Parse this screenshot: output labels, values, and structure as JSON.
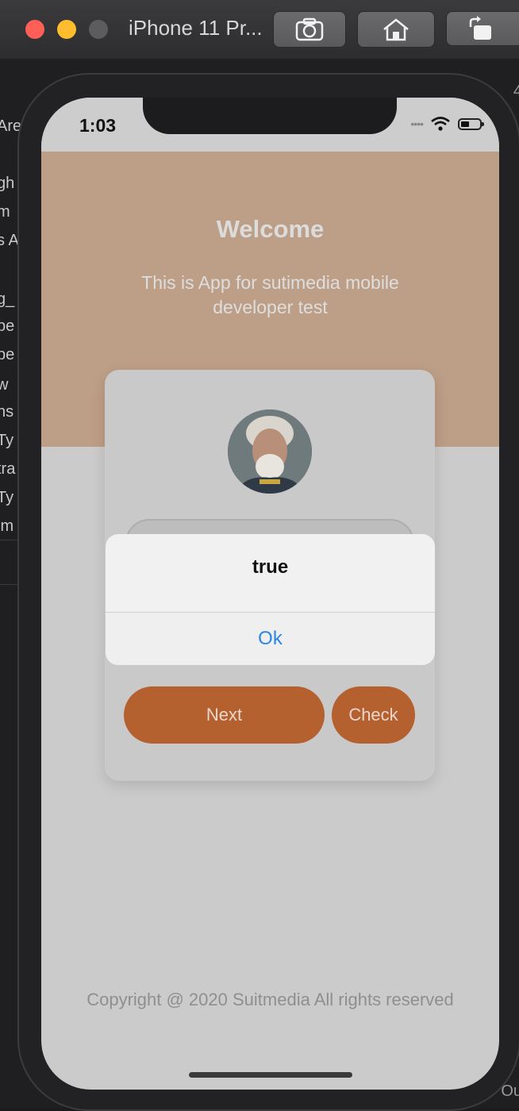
{
  "simulator": {
    "title": "iPhone 11 Pr...",
    "side_fragments_left": [
      "Are",
      "gh",
      "m",
      "s A",
      "g_",
      "pe",
      "pe",
      "w",
      "ns",
      "Ty",
      "tra",
      "Ty",
      "im"
    ],
    "side_fragments_right": [
      "4",
      "Ou"
    ]
  },
  "status_bar": {
    "time": "1:03"
  },
  "hero": {
    "title": "Welcome",
    "subtitle": "This is App for sutimedia mobile developer test"
  },
  "card": {
    "next_label": "Next",
    "check_label": "Check"
  },
  "alert": {
    "title": "true",
    "ok_label": "Ok"
  },
  "footer": {
    "copyright": "Copyright @ 2020 Suitmedia All rights reserved"
  },
  "colors": {
    "hero_bg": "#bd9e86",
    "button_bg": "#b5602f",
    "alert_action": "#2a86e5",
    "screen_bg": "#cbcbcb"
  }
}
